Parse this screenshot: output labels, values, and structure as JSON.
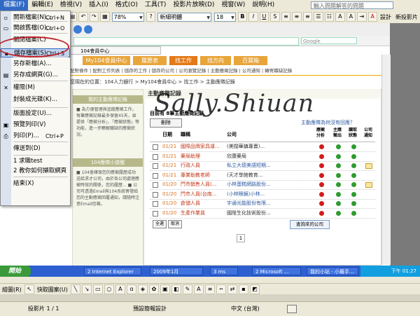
{
  "menubar": {
    "items": [
      "檔案(F)",
      "編輯(E)",
      "檢視(V)",
      "插入(I)",
      "格式(O)",
      "工具(T)",
      "投影片放映(D)",
      "視窗(W)",
      "說明(H)"
    ],
    "help_placeholder": "輸入問題解答的問題"
  },
  "toolbar": {
    "zoom": "78%",
    "font": "新細明體",
    "size": "18",
    "bold": "B",
    "italic": "I",
    "underline": "U",
    "design": "設計",
    "new_slide": "新投影片"
  },
  "file_menu": {
    "items": [
      {
        "label": "開新檔案(N)...",
        "shortcut": "Ctrl+N"
      },
      {
        "label": "開啟舊檔(O)...",
        "shortcut": "Ctrl+O"
      },
      {
        "label": "關閉檔案(C)",
        "shortcut": ""
      },
      {
        "label": "儲存檔案(S)",
        "shortcut": "Ctrl+S"
      },
      {
        "label": "另存新檔(A)...",
        "shortcut": ""
      },
      {
        "label": "另存成網頁(G)...",
        "shortcut": ""
      },
      {
        "label": "權限(M)",
        "shortcut": ""
      },
      {
        "label": "封裝成光碟(K)...",
        "shortcut": ""
      },
      {
        "label": "版面設定(U)...",
        "shortcut": ""
      },
      {
        "label": "預覽列印(V)",
        "shortcut": ""
      },
      {
        "label": "列印(P)...",
        "shortcut": "Ctrl+P"
      },
      {
        "label": "傳送到(D)",
        "shortcut": ""
      },
      {
        "label": "1 求職test",
        "shortcut": ""
      },
      {
        "label": "2 教你如何擷取網頁",
        "shortcut": ""
      },
      {
        "label": "結束(X)",
        "shortcut": ""
      }
    ]
  },
  "browser": {
    "tab": "104會員中心",
    "search_placeholder": "Google"
  },
  "web": {
    "tabs": [
      "My104會員中心",
      "履歷表",
      "找工作",
      "找方向",
      "百寶箱"
    ],
    "subnav": "配對條件 | 配對工作列表 | 儲存的工作 | 儲存的公司 | 公司瀏覽記錄 | 主動應徵記錄 | 公司通知 | 轉寄職缺記錄",
    "breadcrumb": "您現在的位置：104人力銀行 > My104會員中心 > 找工作 > 主動應徵記錄",
    "left_head1": "我的主動應徵記錄",
    "left_text1": "■ 為方便管理與追蹤應徵工作，每筆應徵記錄最多保留45天，並提供「應徵分析」、「應徵狀態」等功能，進一步瞭解職缺的應徵狀況。",
    "left_head2": "104應徵小提醒",
    "left_text2": "■ 104會確保您的應徵履歷成功送給求才公司，由於各公司處理應徵時效的關係，您的履歷... ■ 公司可透過Email與104系統寄發給您的主動應徵回覆通知，請隨時注意Email信箱。",
    "main_head": "主動應徵記錄",
    "watermark": "Sally.Shiuan",
    "summary": "目前有 8筆主動應徵記錄",
    "delete_btn": "刪除",
    "feedback_link": "主動應徵為何沒有回應？",
    "col_date": "日期",
    "col_job": "職稱",
    "col_company": "公司",
    "col_analysis": "應徵分析",
    "col_status": "主應徵出",
    "col_read": "讀取狀態",
    "col_notice": "公司通知",
    "rows": [
      {
        "date": "01/21",
        "job": "國際品牌家具運...",
        "company": "(美闊華鎮專賣)..."
      },
      {
        "date": "01/21",
        "job": "藥局助理",
        "company": "欣康藥局"
      },
      {
        "date": "01/21",
        "job": "行政人員",
        "company": "私立大德美語短期..."
      },
      {
        "date": "01/21",
        "job": "專業助教老師",
        "company": "(天才學館教育..."
      },
      {
        "date": "01/20",
        "job": "門市銷售人員(...",
        "company": "小林蛋糕網路股份..."
      },
      {
        "date": "01/20",
        "job": "門市人員(台南...",
        "company": "(小林眼鏡)小林..."
      },
      {
        "date": "01/20",
        "job": "倉儲人員",
        "company": "宇通光能股份有限..."
      },
      {
        "date": "01/20",
        "job": "生產作業員",
        "company": "國陞生化技術股份..."
      }
    ],
    "select_all": "全選",
    "cancel": "取消",
    "page_num": "1",
    "view_company": "查詢來的公司"
  },
  "taskbar": {
    "start": "開始",
    "tasks": [
      "2 Internet Explorer",
      "2009年1月",
      "3 ms",
      "2 Microsoft ...",
      "我的小站 - 小羅手..."
    ],
    "clock": "下午 01:27"
  },
  "drawbar": {
    "draw": "繪圖(R)",
    "autoshape": "快取圖案(U)"
  },
  "status": {
    "slide": "投影片 1 / 1",
    "design": "預設簡報設計",
    "lang": "中文 (台灣)"
  }
}
